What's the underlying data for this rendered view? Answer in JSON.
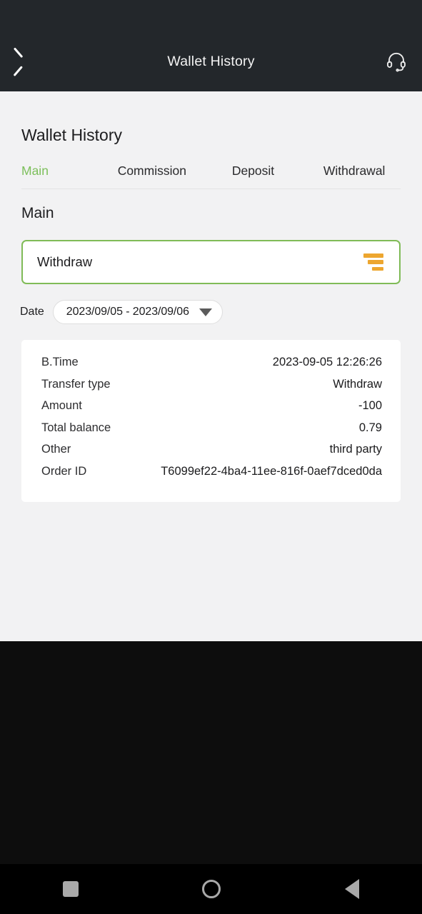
{
  "appbar": {
    "back_icon": "chevron-left-icon",
    "title": "Wallet History",
    "support_icon": "headset-icon"
  },
  "page": {
    "title": "Wallet History",
    "section_title": "Main"
  },
  "tabs": [
    {
      "label": "Main",
      "active": true
    },
    {
      "label": "Commission",
      "active": false
    },
    {
      "label": "Deposit",
      "active": false
    },
    {
      "label": "Withdrawal",
      "active": false
    }
  ],
  "type_selector": {
    "value": "Withdraw",
    "icon": "filter-bars-icon",
    "icon_color": "#eda62f",
    "border_color": "#80bb57"
  },
  "date_filter": {
    "label": "Date",
    "value": "2023/09/05 - 2023/09/06",
    "caret_icon": "caret-down-icon"
  },
  "record": {
    "rows": [
      {
        "label": "B.Time",
        "value": "2023-09-05 12:26:26"
      },
      {
        "label": "Transfer type",
        "value": "Withdraw"
      },
      {
        "label": "Amount",
        "value": "-100"
      },
      {
        "label": "Total balance",
        "value": "0.79"
      },
      {
        "label": "Other",
        "value": "third party"
      },
      {
        "label": "Order ID",
        "value": "T6099ef22-4ba4-11ee-816f-0aef7dced0da"
      }
    ]
  },
  "navbar": {
    "recents_icon": "square-icon",
    "home_icon": "circle-icon",
    "back_icon": "triangle-left-icon"
  },
  "colors": {
    "accent_green": "#7cbf5a",
    "accent_orange": "#eda62f",
    "appbar_bg": "#23272b",
    "content_bg": "#f2f2f3"
  }
}
